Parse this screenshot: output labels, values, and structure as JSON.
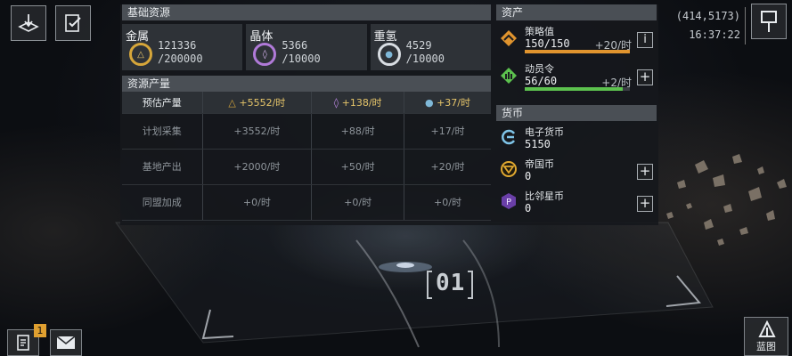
{
  "coords": {
    "position": "(414,5173)",
    "time": "16:37:22"
  },
  "base_resources": {
    "title": "基础资源",
    "items": [
      {
        "name": "金属",
        "current": "121336",
        "capacity": "/200000",
        "icon": "triangle-icon",
        "color": "#d6a63a"
      },
      {
        "name": "晶体",
        "current": "5366",
        "capacity": "/10000",
        "icon": "crystal-icon",
        "color": "#b07ad8"
      },
      {
        "name": "重氢",
        "current": "4529",
        "capacity": "/10000",
        "icon": "deuterium-icon",
        "color": "#7fb8d8"
      }
    ]
  },
  "production": {
    "title": "资源产量",
    "header_label": "预估产量",
    "header_values": [
      "+5552/时",
      "+138/时",
      "+37/时"
    ],
    "rows": [
      {
        "label": "计划采集",
        "values": [
          "+3552/时",
          "+88/时",
          "+17/时"
        ]
      },
      {
        "label": "基地产出",
        "values": [
          "+2000/时",
          "+50/时",
          "+20/时"
        ]
      },
      {
        "label": "同盟加成",
        "values": [
          "+0/时",
          "+0/时",
          "+0/时"
        ]
      }
    ]
  },
  "assets": {
    "title": "资产",
    "strategy": {
      "label": "策略值",
      "value": "150/150",
      "rate": "+20/时",
      "fill": 1.0,
      "color": "#e0942e",
      "btn": "i"
    },
    "mobilization": {
      "label": "动员令",
      "value": "56/60",
      "rate": "+2/时",
      "fill": 0.93,
      "color": "#5cc24e",
      "btn": "+"
    }
  },
  "currency": {
    "title": "货币",
    "items": [
      {
        "label": "电子货币",
        "value": "5150",
        "icon": "e-currency-icon",
        "btn": ""
      },
      {
        "label": "帝国币",
        "value": "0",
        "icon": "empire-coin-icon",
        "btn": "+"
      },
      {
        "label": "比邻星币",
        "value": "0",
        "icon": "proxima-coin-icon",
        "btn": "+"
      }
    ]
  },
  "scene": {
    "zone_label": "01",
    "blueprint_label": "蓝图"
  },
  "notifications": {
    "badge": "1"
  }
}
